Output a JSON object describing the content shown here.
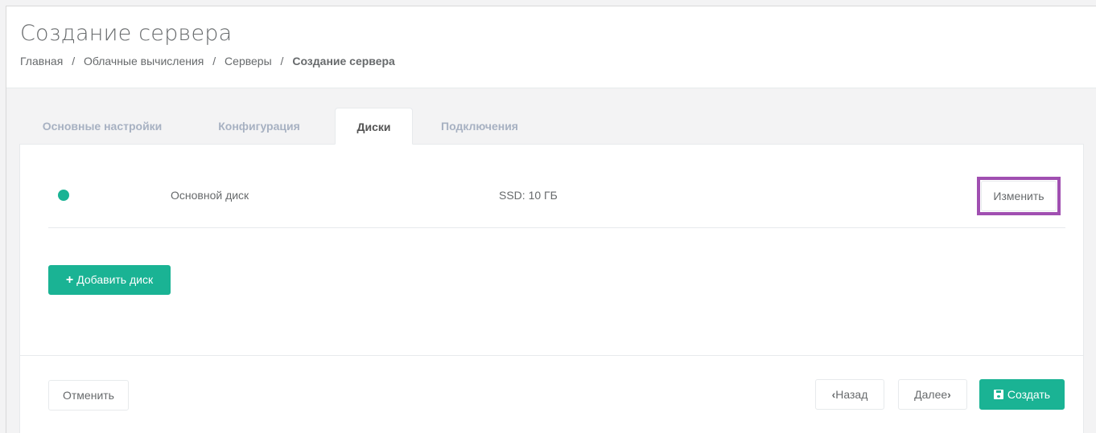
{
  "header": {
    "title": "Создание сервера",
    "breadcrumb": [
      "Главная",
      "Облачные вычисления",
      "Серверы",
      "Создание сервера"
    ],
    "breadcrumb_separator": "/"
  },
  "tabs": [
    {
      "label": "Основные настройки",
      "active": false
    },
    {
      "label": "Конфигурация",
      "active": false
    },
    {
      "label": "Диски",
      "active": true
    },
    {
      "label": "Подключения",
      "active": false
    }
  ],
  "disks": [
    {
      "status_color": "#1ab394",
      "name": "Основной диск",
      "size": "SSD: 10 ГБ",
      "edit_label": "Изменить"
    }
  ],
  "add_disk_label": "Добавить диск",
  "footer": {
    "cancel_label": "Отменить",
    "back_label": "Назад",
    "next_label": "Далее",
    "create_label": "Создать"
  },
  "colors": {
    "accent": "#1ab394",
    "highlight": "#a04fb1"
  },
  "icons": {
    "add": "plus-icon",
    "back": "chevron-left-icon",
    "next": "chevron-right-icon",
    "create": "save-icon"
  }
}
